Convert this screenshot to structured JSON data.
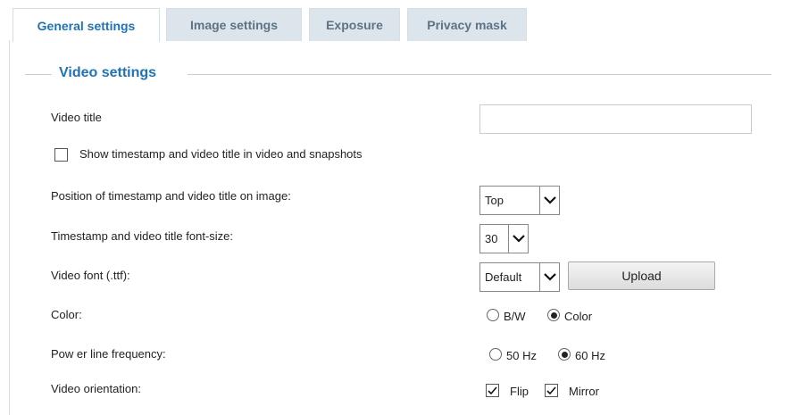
{
  "tabs": [
    {
      "label": "General settings",
      "active": true
    },
    {
      "label": "Image settings",
      "active": false
    },
    {
      "label": "Exposure",
      "active": false
    },
    {
      "label": "Privacy mask",
      "active": false
    }
  ],
  "section": {
    "title": "Video settings"
  },
  "video_title": {
    "label": "Video title",
    "value": ""
  },
  "show_timestamp": {
    "label": "Show  timestamp and video title in video and snapshots",
    "checked": false
  },
  "position": {
    "label": "Position of timestamp and video title on image:",
    "value": "Top"
  },
  "font_size": {
    "label": "Timestamp and video title font-size:",
    "value": "30"
  },
  "video_font": {
    "label": "Video font (.ttf):",
    "value": "Default",
    "upload_label": "Upload"
  },
  "color": {
    "label": "Color:",
    "options": [
      "B/W",
      "Color"
    ],
    "selected": "Color"
  },
  "power_line": {
    "label": "Pow er line frequency:",
    "options": [
      "50 Hz",
      "60 Hz"
    ],
    "selected": "60 Hz"
  },
  "orientation": {
    "label": "Video orientation:",
    "flip_label": "Flip",
    "mirror_label": "Mirror",
    "flip": true,
    "mirror": true
  },
  "colors": {
    "accent": "#1f73b7",
    "tab_bg": "#dce5ec",
    "tab_text": "#5d7384"
  }
}
